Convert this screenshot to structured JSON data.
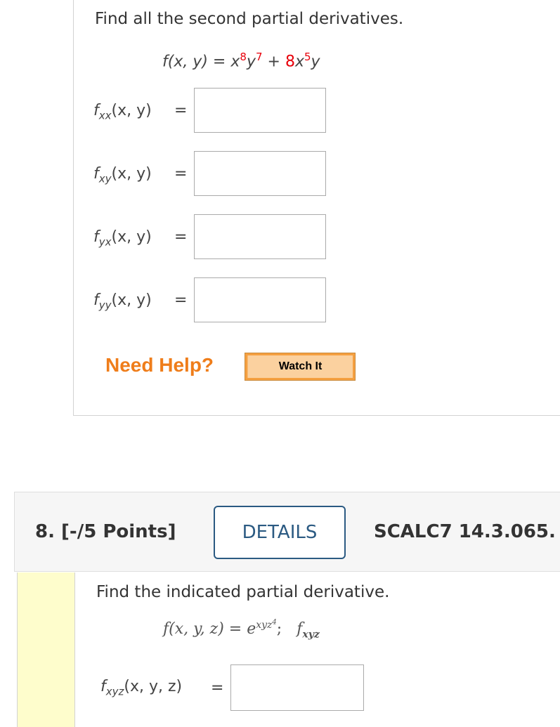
{
  "q7": {
    "prompt": "Find all the second partial derivatives.",
    "function": {
      "lhs": "f(x, y) = ",
      "term1_base1": "x",
      "term1_exp1": "8",
      "term1_base2": "y",
      "term1_exp2": "7",
      "plus": " + ",
      "term2_coef": "8",
      "term2_base": "x",
      "term2_exp": "5",
      "term2_tail": "y"
    },
    "rows": [
      {
        "f": "f",
        "sub": "xx",
        "args": "(x, y)",
        "eq": "="
      },
      {
        "f": "f",
        "sub": "xy",
        "args": "(x, y)",
        "eq": "="
      },
      {
        "f": "f",
        "sub": "yx",
        "args": "(x, y)",
        "eq": "="
      },
      {
        "f": "f",
        "sub": "yy",
        "args": "(x, y)",
        "eq": "="
      }
    ],
    "need_help": "Need Help?",
    "watch_it": "Watch It"
  },
  "q8": {
    "number_points": "8. [-/5 Points]",
    "details": "DETAILS",
    "code": "SCALC7 14.3.065.",
    "prompt": "Find the indicated partial derivative.",
    "function": {
      "lhs": "f(x, y, z) = e",
      "exp_base": "xyz",
      "exp_power": "4",
      "sep": ";",
      "target_f": "f",
      "target_sub": "xyz"
    },
    "answer_row": {
      "f": "f",
      "sub": "xyz",
      "args": "(x, y, z)",
      "eq": "="
    }
  },
  "colors": {
    "highlight_red": "#e8000b",
    "need_help_orange": "#ef7d1a",
    "details_blue": "#2b5a82",
    "sidebar_yellow": "#fefdcc"
  }
}
